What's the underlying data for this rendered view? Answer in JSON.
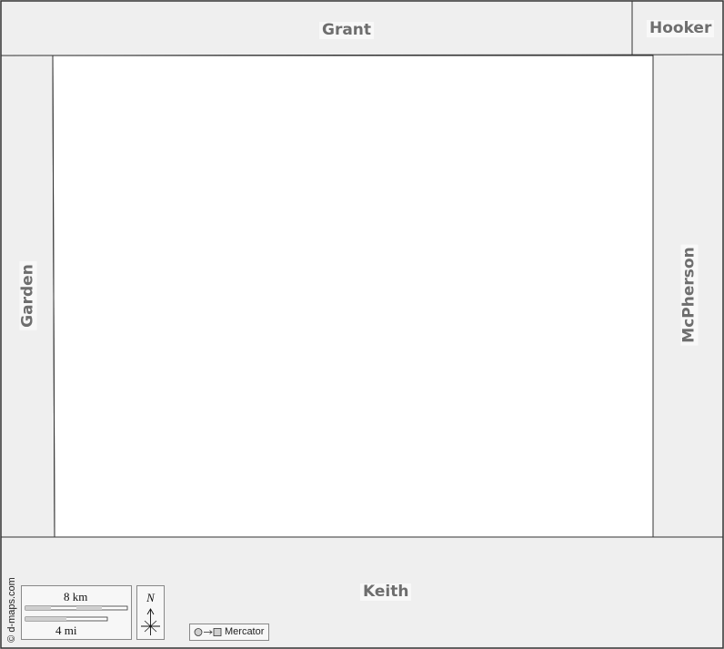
{
  "map": {
    "counties": {
      "north": "Grant",
      "northeast": "Hooker",
      "west": "Garden",
      "east": "McPherson",
      "south": "Keith"
    },
    "credit": "© d-maps.com",
    "scale": {
      "km_label": "8 km",
      "mi_label": "4 mi"
    },
    "north_arrow": {
      "letter": "N",
      "icon": "compass-arrow-icon"
    },
    "projection": {
      "label": "Mercator",
      "icon": "circle-to-square-icon"
    },
    "colors": {
      "surrounding_area": "#efefef",
      "focus_area": "#ffffff",
      "border": "#333333",
      "label_text": "#6e6e6e"
    }
  }
}
